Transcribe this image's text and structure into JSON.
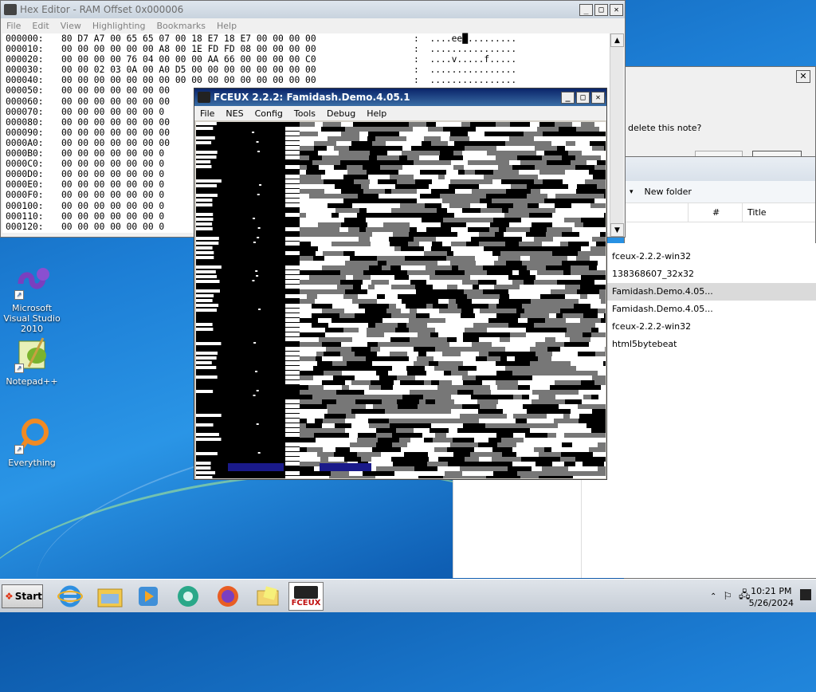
{
  "hex_editor": {
    "title": "Hex Editor - RAM Offset 0x000006",
    "menu": [
      "File",
      "Edit",
      "View",
      "Highlighting",
      "Bookmarks",
      "Help"
    ],
    "rows": [
      {
        "addr": "000000:",
        "bytes": "80 D7 A7 00 65 65 07 00 18 E7 18 E7 00 00 00 00",
        "ascii": ":  ....ee█........."
      },
      {
        "addr": "000010:",
        "bytes": "00 00 00 00 00 00 A8 00 1E FD FD 08 00 00 00 00",
        "ascii": ":  ................"
      },
      {
        "addr": "000020:",
        "bytes": "00 00 00 00 76 04 00 00 00 AA 66 00 00 00 00 C0",
        "ascii": ":  ....v.....f....."
      },
      {
        "addr": "000030:",
        "bytes": "00 00 02 03 0A 00 A0 D5 00 00 00 00 00 00 00 00",
        "ascii": ":  ................"
      },
      {
        "addr": "000040:",
        "bytes": "00 00 00 00 00 00 00 00 00 00 00 00 00 00 00 00",
        "ascii": ":  ................"
      },
      {
        "addr": "000050:",
        "bytes": "00 00 00 00 00 00 00",
        "ascii": ""
      },
      {
        "addr": "000060:",
        "bytes": "00 00 00 00 00 00 00",
        "ascii": ""
      },
      {
        "addr": "000070:",
        "bytes": "00 00 00 00 00 00 0",
        "ascii": ""
      },
      {
        "addr": "000080:",
        "bytes": "00 00 00 00 00 00 00",
        "ascii": ""
      },
      {
        "addr": "000090:",
        "bytes": "00 00 00 00 00 00 00",
        "ascii": ""
      },
      {
        "addr": "0000A0:",
        "bytes": "00 00 00 00 00 00 00",
        "ascii": ""
      },
      {
        "addr": "0000B0:",
        "bytes": "00 00 00 00 00 00 0",
        "ascii": ""
      },
      {
        "addr": "0000C0:",
        "bytes": "00 00 00 00 00 00 0",
        "ascii": ""
      },
      {
        "addr": "0000D0:",
        "bytes": "00 00 00 00 00 00 0",
        "ascii": ""
      },
      {
        "addr": "0000E0:",
        "bytes": "00 00 00 00 00 00 0",
        "ascii": ""
      },
      {
        "addr": "0000F0:",
        "bytes": "00 00 00 00 00 00 0",
        "ascii": ""
      },
      {
        "addr": "000100:",
        "bytes": "00 00 00 00 00 00 0",
        "ascii": ""
      },
      {
        "addr": "000110:",
        "bytes": "00 00 00 00 00 00 0",
        "ascii": ""
      },
      {
        "addr": "000120:",
        "bytes": "00 00 00 00 00 00 0",
        "ascii": ""
      }
    ]
  },
  "dialog": {
    "text": "delete this note?"
  },
  "explorer": {
    "new_folder": "New folder",
    "col_hash": "#",
    "col_title": "Title",
    "items": [
      "fceux-2.2.2-win32",
      "138368607_32x32",
      "Famidash.Demo.4.05...",
      "Famidash.Demo.4.05...",
      "fceux-2.2.2-win32",
      "html5bytebeat"
    ]
  },
  "fceux": {
    "title": "FCEUX 2.2.2: Famidash.Demo.4.05.1",
    "menu": [
      "File",
      "NES",
      "Config",
      "Tools",
      "Debug",
      "Help"
    ]
  },
  "desktop_icons": [
    {
      "label": "Microsoft Visual Studio 2010",
      "icon": "visual-studio-icon"
    },
    {
      "label": "Notepad++",
      "icon": "notepad-plus-plus-icon"
    },
    {
      "label": "Everything",
      "icon": "everything-search-icon"
    }
  ],
  "taskbar": {
    "start_label": "Start",
    "time": "10:21 PM",
    "date": "5/26/2024",
    "apps": [
      "internet-explorer-icon",
      "file-explorer-icon",
      "media-player-icon",
      "chrome-like-icon",
      "firefox-icon",
      "folder-notes-icon",
      "fceux-icon"
    ],
    "fceux_label": "FCEUX"
  },
  "colors": {
    "active_title": "#0a246a",
    "desktop_blue": "#1d7fd6",
    "highlight_row": "#dadada"
  }
}
